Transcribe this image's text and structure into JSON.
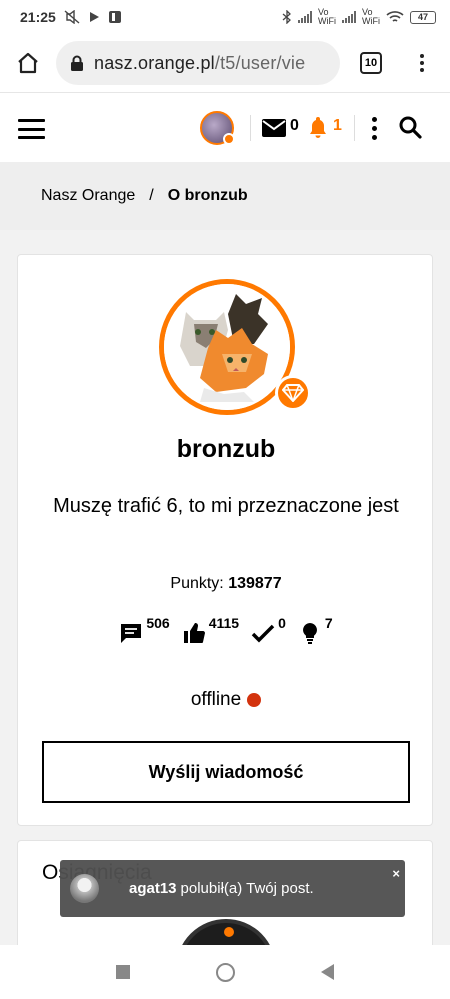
{
  "status_bar": {
    "time": "21:25",
    "battery": "47",
    "network_1": "Vo WiFi",
    "network_2": "Vo WiFi"
  },
  "browser": {
    "url_host": "nasz.orange.pl",
    "url_path": "/t5/user/vie",
    "tab_count": "10"
  },
  "header": {
    "messages_count": "0",
    "notifications_count": "1"
  },
  "breadcrumb": {
    "home": "Nasz Orange",
    "separator": "/",
    "current": "O bronzub"
  },
  "profile": {
    "username": "bronzub",
    "motto": "Muszę trafić 6, to mi przeznaczone jest",
    "points_label": "Punkty:",
    "points_value": "139877",
    "stats": {
      "messages": "506",
      "likes": "4115",
      "solutions": "0",
      "ideas": "7"
    },
    "status": "offline",
    "send_message_label": "Wyślij wiadomość"
  },
  "achievements": {
    "title": "Osiągnięcia"
  },
  "toast": {
    "user": "agat13",
    "message": "polubił(a) Twój post.",
    "close": "×"
  },
  "colors": {
    "accent": "#ff7900",
    "offline": "#d3330e"
  }
}
